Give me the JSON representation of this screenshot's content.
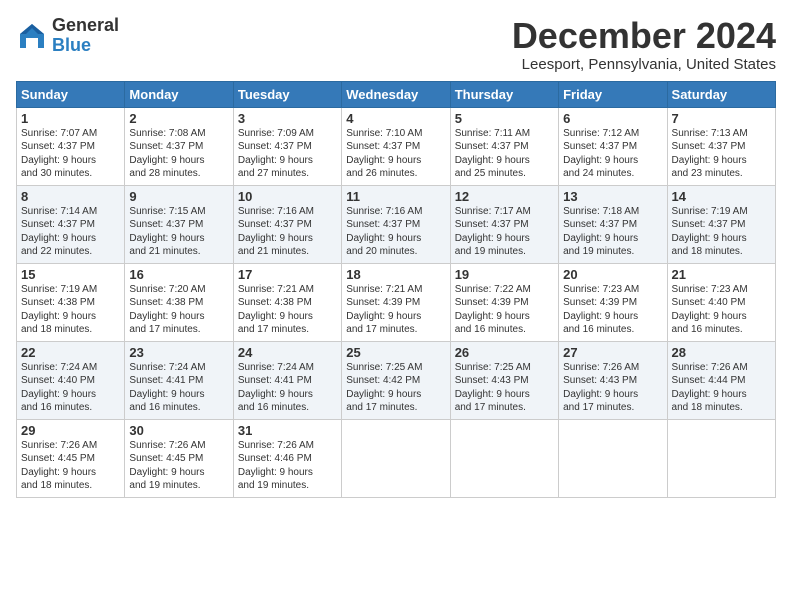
{
  "header": {
    "logo_general": "General",
    "logo_blue": "Blue",
    "month_title": "December 2024",
    "location": "Leesport, Pennsylvania, United States"
  },
  "days_of_week": [
    "Sunday",
    "Monday",
    "Tuesday",
    "Wednesday",
    "Thursday",
    "Friday",
    "Saturday"
  ],
  "weeks": [
    [
      {
        "day": "1",
        "lines": [
          "Sunrise: 7:07 AM",
          "Sunset: 4:37 PM",
          "Daylight: 9 hours",
          "and 30 minutes."
        ]
      },
      {
        "day": "2",
        "lines": [
          "Sunrise: 7:08 AM",
          "Sunset: 4:37 PM",
          "Daylight: 9 hours",
          "and 28 minutes."
        ]
      },
      {
        "day": "3",
        "lines": [
          "Sunrise: 7:09 AM",
          "Sunset: 4:37 PM",
          "Daylight: 9 hours",
          "and 27 minutes."
        ]
      },
      {
        "day": "4",
        "lines": [
          "Sunrise: 7:10 AM",
          "Sunset: 4:37 PM",
          "Daylight: 9 hours",
          "and 26 minutes."
        ]
      },
      {
        "day": "5",
        "lines": [
          "Sunrise: 7:11 AM",
          "Sunset: 4:37 PM",
          "Daylight: 9 hours",
          "and 25 minutes."
        ]
      },
      {
        "day": "6",
        "lines": [
          "Sunrise: 7:12 AM",
          "Sunset: 4:37 PM",
          "Daylight: 9 hours",
          "and 24 minutes."
        ]
      },
      {
        "day": "7",
        "lines": [
          "Sunrise: 7:13 AM",
          "Sunset: 4:37 PM",
          "Daylight: 9 hours",
          "and 23 minutes."
        ]
      }
    ],
    [
      {
        "day": "8",
        "lines": [
          "Sunrise: 7:14 AM",
          "Sunset: 4:37 PM",
          "Daylight: 9 hours",
          "and 22 minutes."
        ]
      },
      {
        "day": "9",
        "lines": [
          "Sunrise: 7:15 AM",
          "Sunset: 4:37 PM",
          "Daylight: 9 hours",
          "and 21 minutes."
        ]
      },
      {
        "day": "10",
        "lines": [
          "Sunrise: 7:16 AM",
          "Sunset: 4:37 PM",
          "Daylight: 9 hours",
          "and 21 minutes."
        ]
      },
      {
        "day": "11",
        "lines": [
          "Sunrise: 7:16 AM",
          "Sunset: 4:37 PM",
          "Daylight: 9 hours",
          "and 20 minutes."
        ]
      },
      {
        "day": "12",
        "lines": [
          "Sunrise: 7:17 AM",
          "Sunset: 4:37 PM",
          "Daylight: 9 hours",
          "and 19 minutes."
        ]
      },
      {
        "day": "13",
        "lines": [
          "Sunrise: 7:18 AM",
          "Sunset: 4:37 PM",
          "Daylight: 9 hours",
          "and 19 minutes."
        ]
      },
      {
        "day": "14",
        "lines": [
          "Sunrise: 7:19 AM",
          "Sunset: 4:37 PM",
          "Daylight: 9 hours",
          "and 18 minutes."
        ]
      }
    ],
    [
      {
        "day": "15",
        "lines": [
          "Sunrise: 7:19 AM",
          "Sunset: 4:38 PM",
          "Daylight: 9 hours",
          "and 18 minutes."
        ]
      },
      {
        "day": "16",
        "lines": [
          "Sunrise: 7:20 AM",
          "Sunset: 4:38 PM",
          "Daylight: 9 hours",
          "and 17 minutes."
        ]
      },
      {
        "day": "17",
        "lines": [
          "Sunrise: 7:21 AM",
          "Sunset: 4:38 PM",
          "Daylight: 9 hours",
          "and 17 minutes."
        ]
      },
      {
        "day": "18",
        "lines": [
          "Sunrise: 7:21 AM",
          "Sunset: 4:39 PM",
          "Daylight: 9 hours",
          "and 17 minutes."
        ]
      },
      {
        "day": "19",
        "lines": [
          "Sunrise: 7:22 AM",
          "Sunset: 4:39 PM",
          "Daylight: 9 hours",
          "and 16 minutes."
        ]
      },
      {
        "day": "20",
        "lines": [
          "Sunrise: 7:23 AM",
          "Sunset: 4:39 PM",
          "Daylight: 9 hours",
          "and 16 minutes."
        ]
      },
      {
        "day": "21",
        "lines": [
          "Sunrise: 7:23 AM",
          "Sunset: 4:40 PM",
          "Daylight: 9 hours",
          "and 16 minutes."
        ]
      }
    ],
    [
      {
        "day": "22",
        "lines": [
          "Sunrise: 7:24 AM",
          "Sunset: 4:40 PM",
          "Daylight: 9 hours",
          "and 16 minutes."
        ]
      },
      {
        "day": "23",
        "lines": [
          "Sunrise: 7:24 AM",
          "Sunset: 4:41 PM",
          "Daylight: 9 hours",
          "and 16 minutes."
        ]
      },
      {
        "day": "24",
        "lines": [
          "Sunrise: 7:24 AM",
          "Sunset: 4:41 PM",
          "Daylight: 9 hours",
          "and 16 minutes."
        ]
      },
      {
        "day": "25",
        "lines": [
          "Sunrise: 7:25 AM",
          "Sunset: 4:42 PM",
          "Daylight: 9 hours",
          "and 17 minutes."
        ]
      },
      {
        "day": "26",
        "lines": [
          "Sunrise: 7:25 AM",
          "Sunset: 4:43 PM",
          "Daylight: 9 hours",
          "and 17 minutes."
        ]
      },
      {
        "day": "27",
        "lines": [
          "Sunrise: 7:26 AM",
          "Sunset: 4:43 PM",
          "Daylight: 9 hours",
          "and 17 minutes."
        ]
      },
      {
        "day": "28",
        "lines": [
          "Sunrise: 7:26 AM",
          "Sunset: 4:44 PM",
          "Daylight: 9 hours",
          "and 18 minutes."
        ]
      }
    ],
    [
      {
        "day": "29",
        "lines": [
          "Sunrise: 7:26 AM",
          "Sunset: 4:45 PM",
          "Daylight: 9 hours",
          "and 18 minutes."
        ]
      },
      {
        "day": "30",
        "lines": [
          "Sunrise: 7:26 AM",
          "Sunset: 4:45 PM",
          "Daylight: 9 hours",
          "and 19 minutes."
        ]
      },
      {
        "day": "31",
        "lines": [
          "Sunrise: 7:26 AM",
          "Sunset: 4:46 PM",
          "Daylight: 9 hours",
          "and 19 minutes."
        ]
      },
      {
        "day": "",
        "lines": []
      },
      {
        "day": "",
        "lines": []
      },
      {
        "day": "",
        "lines": []
      },
      {
        "day": "",
        "lines": []
      }
    ]
  ]
}
